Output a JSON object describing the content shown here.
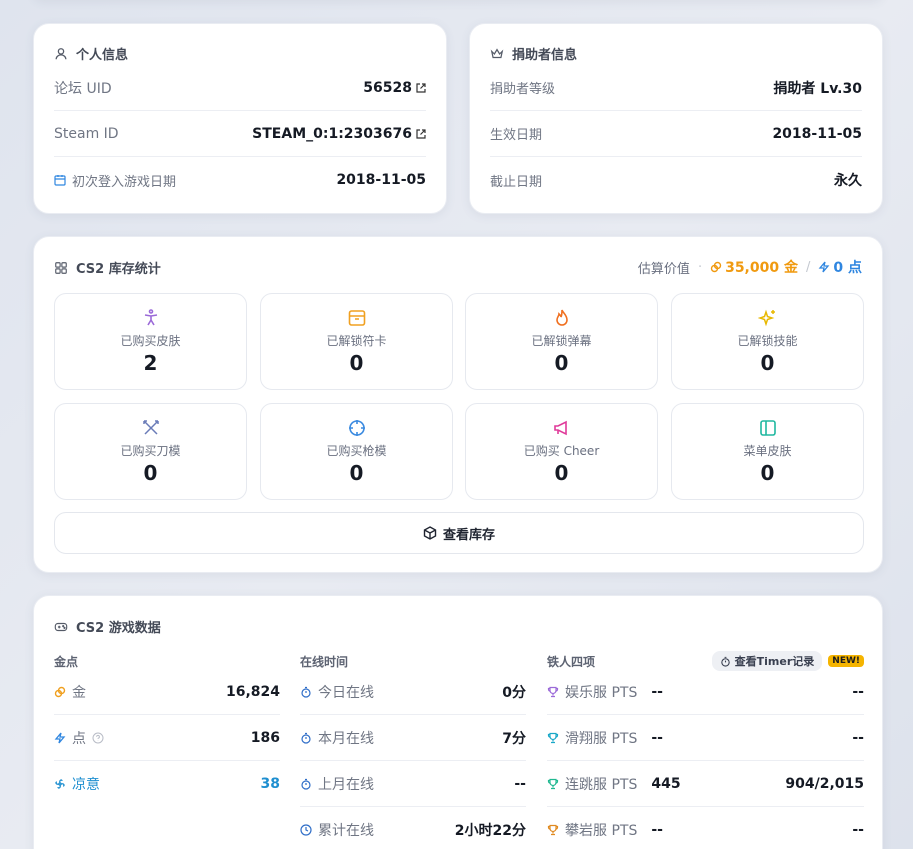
{
  "personal": {
    "title": "个人信息",
    "rows": [
      {
        "label": "论坛 UID",
        "value": "56528"
      },
      {
        "label": "Steam ID",
        "value": "STEAM_0:1:2303676"
      },
      {
        "label": "初次登入游戏日期",
        "value": "2018-11-05"
      }
    ]
  },
  "donor": {
    "title": "捐助者信息",
    "rows": [
      {
        "label": "捐助者等级",
        "value": "捐助者 Lv.30"
      },
      {
        "label": "生效日期",
        "value": "2018-11-05"
      },
      {
        "label": "截止日期",
        "value": "永久"
      }
    ]
  },
  "inventory": {
    "title": "CS2 库存统计",
    "estimate_label": "估算价值",
    "gold_value": "35,000 金",
    "separator": "/",
    "points_value": "0 点",
    "stats": [
      {
        "label": "已购买皮肤",
        "value": "2",
        "icon": "accessibility-icon",
        "color": "#9b6ad8"
      },
      {
        "label": "已解锁符卡",
        "value": "0",
        "icon": "card-icon",
        "color": "#f0a020"
      },
      {
        "label": "已解锁弹幕",
        "value": "0",
        "icon": "flame-icon",
        "color": "#f07020"
      },
      {
        "label": "已解锁技能",
        "value": "0",
        "icon": "sparkles-icon",
        "color": "#e8b800"
      },
      {
        "label": "已购买刀模",
        "value": "0",
        "icon": "swords-icon",
        "color": "#6a7cb8"
      },
      {
        "label": "已购买枪模",
        "value": "0",
        "icon": "crosshair-icon",
        "color": "#3a8ae0"
      },
      {
        "label": "已购买 Cheer",
        "value": "0",
        "icon": "megaphone-icon",
        "color": "#e03a9a"
      },
      {
        "label": "菜单皮肤",
        "value": "0",
        "icon": "panel-icon",
        "color": "#20b8a0"
      }
    ],
    "view_button": "查看库存"
  },
  "game": {
    "title": "CS2 游戏数据",
    "currency": {
      "header": "金点",
      "rows": [
        {
          "label": "金",
          "value": "16,824"
        },
        {
          "label": "点",
          "value": "186"
        },
        {
          "label": "凉意",
          "value": "38"
        }
      ]
    },
    "online": {
      "header": "在线时间",
      "rows": [
        {
          "label": "今日在线",
          "value": "0分"
        },
        {
          "label": "本月在线",
          "value": "7分"
        },
        {
          "label": "上月在线",
          "value": "--"
        },
        {
          "label": "累计在线",
          "value": "2小时22分"
        }
      ]
    },
    "iron": {
      "header": "铁人四项",
      "timer_button": "查看Timer记录",
      "new_badge": "NEW!",
      "rows": [
        {
          "label": "娱乐服 PTS",
          "pts": "--",
          "rank": "--",
          "color": "#9b6ad8"
        },
        {
          "label": "滑翔服 PTS",
          "pts": "--",
          "rank": "--",
          "color": "#1aa8c8"
        },
        {
          "label": "连跳服 PTS",
          "pts": "445",
          "rank": "904/2,015",
          "color": "#20b890"
        },
        {
          "label": "攀岩服 PTS",
          "pts": "--",
          "rank": "--",
          "color": "#e08a20"
        }
      ]
    }
  },
  "colors": {
    "gold": "#f09a10",
    "points": "#2f86e0",
    "cool": "#1f8fd0"
  }
}
